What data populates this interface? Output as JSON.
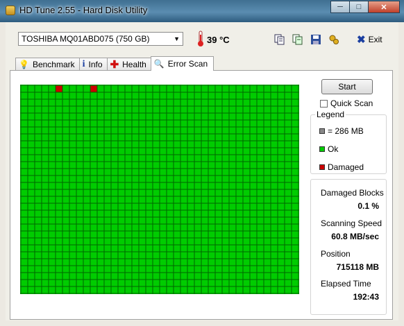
{
  "window": {
    "title": "HD Tune 2.55 - Hard Disk Utility"
  },
  "toolbar": {
    "drive": "TOSHIBA MQ01ABD075 (750 GB)",
    "temperature": "39 °C",
    "exit_label": "Exit"
  },
  "tabs": [
    {
      "label": "Benchmark",
      "icon": "bulb-icon"
    },
    {
      "label": "Info",
      "icon": "info-icon"
    },
    {
      "label": "Health",
      "icon": "health-cross-icon"
    },
    {
      "label": "Error Scan",
      "icon": "magnifier-icon",
      "active": true
    }
  ],
  "scan": {
    "columns": 40,
    "rows": 30,
    "damaged_blocks": [
      [
        0,
        5
      ],
      [
        0,
        10
      ]
    ],
    "colors": {
      "ok": "#00cc00",
      "damaged": "#cc0000",
      "grid_line": "#006600",
      "unscanned": "#888888"
    }
  },
  "controls": {
    "start_label": "Start",
    "quick_scan_label": "Quick Scan"
  },
  "legend": {
    "title": "Legend",
    "items": [
      {
        "label": "= 286 MB",
        "color": "#888888"
      },
      {
        "label": "Ok",
        "color": "#00cc00"
      },
      {
        "label": "Damaged",
        "color": "#cc0000"
      }
    ]
  },
  "stats": {
    "damaged_blocks_label": "Damaged Blocks",
    "damaged_blocks_value": "0.1 %",
    "scanning_speed_label": "Scanning Speed",
    "scanning_speed_value": "60.8 MB/sec",
    "position_label": "Position",
    "position_value": "715118 MB",
    "elapsed_label": "Elapsed Time",
    "elapsed_value": "192:43"
  }
}
